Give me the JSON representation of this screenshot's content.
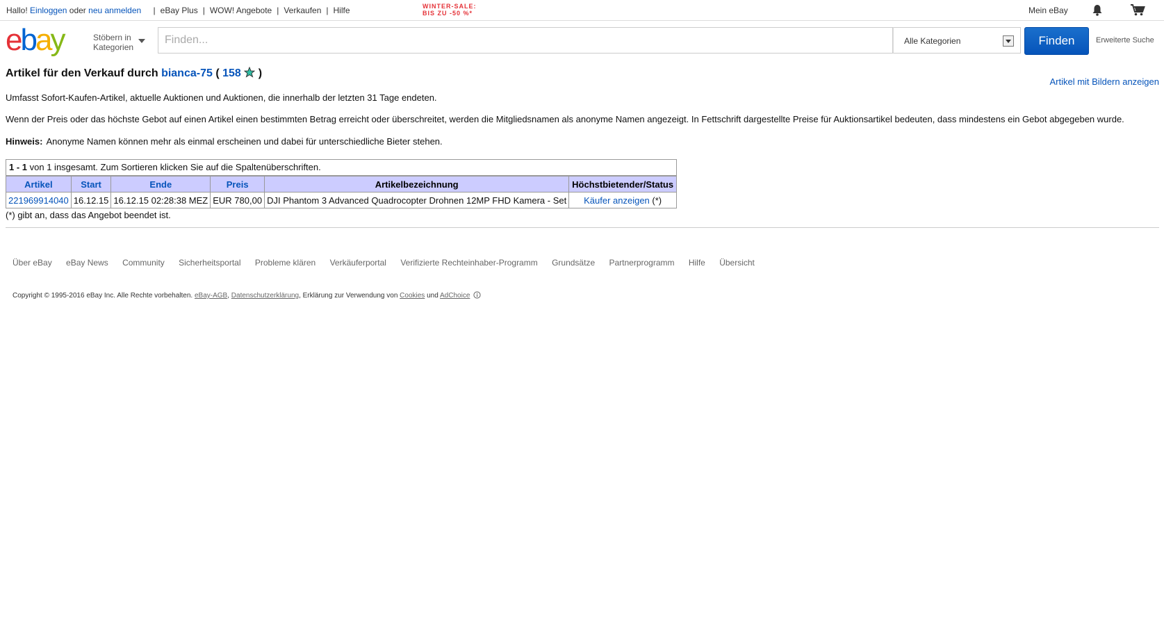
{
  "topbar": {
    "hello": "Hallo!",
    "login": "Einloggen",
    "or": "oder",
    "register": "neu anmelden",
    "links": [
      "eBay Plus",
      "WOW! Angebote",
      "Verkaufen",
      "Hilfe"
    ],
    "promo_line1": "WINTER-SALE:",
    "promo_line2": "BIS ZU -50 %*",
    "my_ebay": "Mein eBay"
  },
  "header": {
    "browse_line1": "Stöbern in",
    "browse_line2": "Kategorien",
    "search_placeholder": "Finden...",
    "category": "Alle Kategorien",
    "find_button": "Finden",
    "advanced": "Erweiterte Suche"
  },
  "main": {
    "title_prefix": "Artikel für den Verkauf durch",
    "seller": "bianca-75",
    "paren_open": "(",
    "feedback": "158",
    "paren_close": ")",
    "pics_link": "Artikel mit Bildern anzeigen",
    "p1": "Umfasst Sofort-Kaufen-Artikel, aktuelle Auktionen und Auktionen, die innerhalb der letzten 31 Tage endeten.",
    "p2": "Wenn der Preis oder das höchste Gebot auf einen Artikel einen bestimmten Betrag erreicht oder überschreitet, werden die Mitgliedsnamen als anonyme Namen angezeigt. In Fettschrift dargestellte Preise für Auktionsartikel bedeuten, dass mindestens ein Gebot abgegeben wurde.",
    "hint_label": "Hinweis:",
    "hint_text": "Anonyme Namen können mehr als einmal erscheinen und dabei für unterschiedliche Bieter stehen."
  },
  "table": {
    "range": "1 - 1",
    "count_text": "von 1 insgesamt. Zum Sortieren klicken Sie auf die Spaltenüberschriften.",
    "headers": [
      "Artikel",
      "Start",
      "Ende",
      "Preis",
      "Artikelbezeichnung",
      "Höchstbietender/Status"
    ],
    "rows": [
      {
        "item": "221969914040",
        "start": "16.12.15",
        "end": "16.12.15 02:28:38 MEZ",
        "price": "EUR 780,00",
        "title": "DJI Phantom 3 Advanced Quadrocopter Drohnen 12MP FHD Kamera - Set",
        "status_link": "Käufer anzeigen",
        "status_suffix": "(*)"
      }
    ],
    "note": "(*) gibt an, dass das Angebot beendet ist."
  },
  "footer": {
    "links": [
      "Über eBay",
      "eBay News",
      "Community",
      "Sicherheitsportal",
      "Probleme klären",
      "Verkäuferportal",
      "Verifizierte Rechteinhaber-Programm",
      "Grundsätze",
      "Partnerprogramm",
      "Hilfe",
      "Übersicht"
    ],
    "copyright_prefix": "Copyright © 1995-2016 eBay Inc. Alle Rechte vorbehalten.",
    "agb": "eBay-AGB",
    "comma1": ",",
    "privacy": "Datenschutzerklärung",
    "cookies_prefix": ", Erklärung zur Verwendung von",
    "cookies": "Cookies",
    "and": "und",
    "adchoice": "AdChoice"
  },
  "colors": {
    "link": "#0654ba",
    "header_bg": "#ccccff",
    "find_button": "#0654ba",
    "promo": "#e53238"
  }
}
